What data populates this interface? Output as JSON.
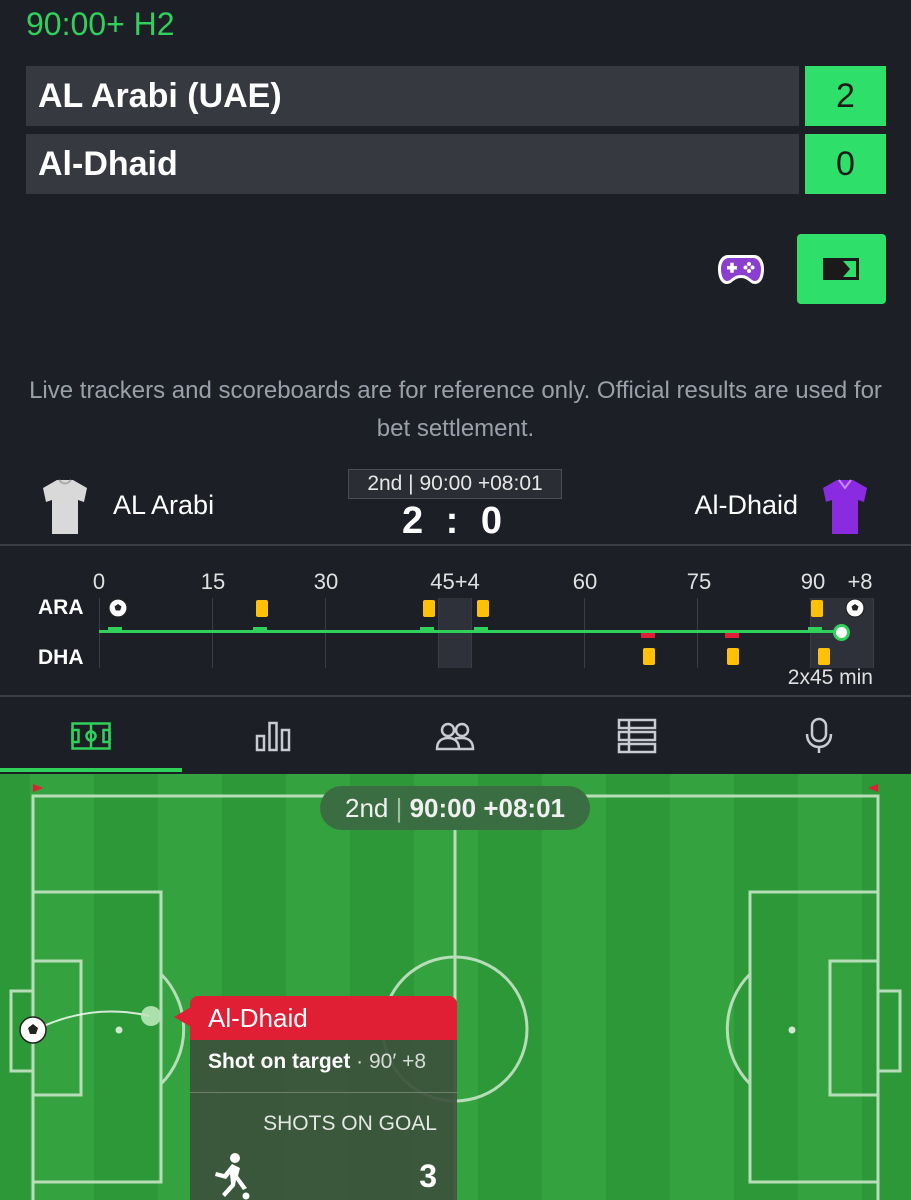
{
  "header": {
    "match_time": "90:00+ H2"
  },
  "scoreboard": {
    "teams": [
      {
        "name": "AL Arabi (UAE)",
        "score": "2"
      },
      {
        "name": "Al-Dhaid",
        "score": "0"
      }
    ]
  },
  "actions": {
    "game_icon": "gamepad-icon",
    "tv_icon": "tv-stream-icon"
  },
  "disclaimer": "Live trackers and scoreboards are for reference only. Official results are used for bet settlement.",
  "match": {
    "home_name": "AL Arabi",
    "away_name": "Al-Dhaid",
    "period": "2nd | 90:00 +08:01",
    "score": "2 : 0",
    "home_jersey_color": "#d9d9d9",
    "away_jersey_color": "#8a2be2"
  },
  "timeline": {
    "ticks": [
      "0",
      "15",
      "30",
      "45+4",
      "60",
      "75",
      "90",
      "+8"
    ],
    "home_abbr": "ARA",
    "away_abbr": "DHA",
    "duration": "2x45 min"
  },
  "tabs": [
    {
      "name": "pitch-tab",
      "icon": "pitch-icon",
      "active": true
    },
    {
      "name": "stats-tab",
      "icon": "bar-chart-icon"
    },
    {
      "name": "lineups-tab",
      "icon": "players-icon"
    },
    {
      "name": "events-tab",
      "icon": "list-icon"
    },
    {
      "name": "commentary-tab",
      "icon": "microphone-icon"
    }
  ],
  "pitch": {
    "period_label": "2nd",
    "period_time": "90:00 +08:01",
    "popup": {
      "team": "Al-Dhaid",
      "event": "Shot on target",
      "time": "· 90′ +8",
      "stat_label": "SHOTS ON GOAL",
      "stat_value": "3"
    }
  },
  "colors": {
    "accent": "#2fd15b",
    "away": "#e01f35",
    "card": "#ffc107"
  }
}
